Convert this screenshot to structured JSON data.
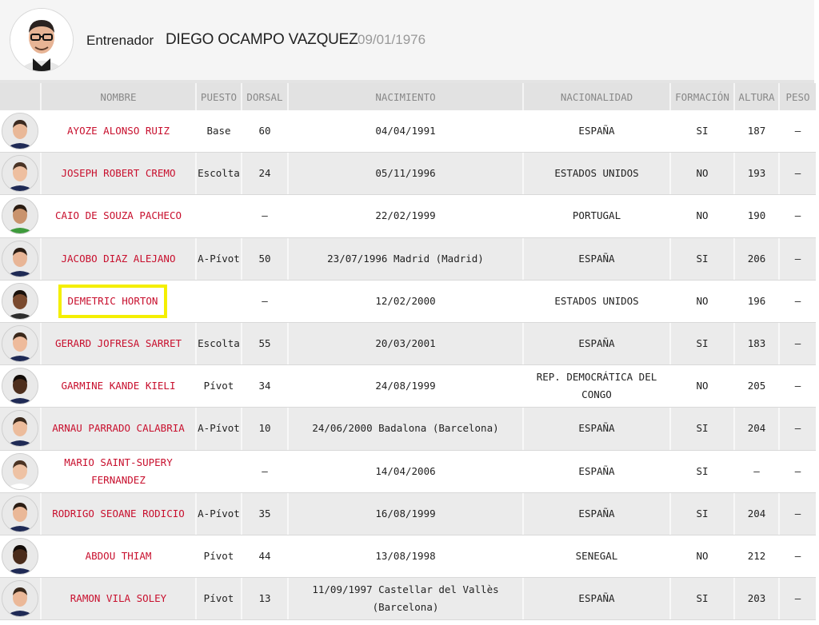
{
  "coach": {
    "role": "Entrenador",
    "name": "DIEGO OCAMPO VAZQUEZ",
    "birthdate": "09/01/1976"
  },
  "headers": {
    "nombre": "NOMBRE",
    "puesto": "PUESTO",
    "dorsal": "DORSAL",
    "nacimiento": "NACIMIENTO",
    "nacionalidad": "NACIONALIDAD",
    "formacion": "FORMACIÓN",
    "altura": "ALTURA",
    "peso": "PESO"
  },
  "colors": {
    "link": "#c8102e",
    "highlight": "#f4ef00",
    "header_bg": "#e2e2e2",
    "alt_row": "#ebebeb"
  },
  "highlighted_index": 4,
  "players": [
    {
      "name": "AYOZE ALONSO RUIZ",
      "position": "Base",
      "number": "60",
      "birth": "04/04/1991",
      "nationality": "ESPAÑA",
      "formation": "SI",
      "height": "187",
      "weight": "–",
      "skin": "#e9b898",
      "hair": "#3b2a20",
      "jersey": "#1f2a55"
    },
    {
      "name": "JOSEPH ROBERT CREMO",
      "position": "Escolta",
      "number": "24",
      "birth": "05/11/1996",
      "nationality": "ESTADOS UNIDOS",
      "formation": "NO",
      "height": "193",
      "weight": "–",
      "skin": "#eebfa0",
      "hair": "#4a3426",
      "jersey": "#1f2a55"
    },
    {
      "name": "CAIO DE SOUZA PACHECO",
      "position": "",
      "number": "–",
      "birth": "22/02/1999",
      "nationality": "PORTUGAL",
      "formation": "NO",
      "height": "190",
      "weight": "–",
      "skin": "#c9936d",
      "hair": "#2a1c12",
      "jersey": "#3d9a3b"
    },
    {
      "name": "JACOBO DIAZ ALEJANO",
      "position": "A-Pívot",
      "number": "50",
      "birth": "23/07/1996 Madrid (Madrid)",
      "nationality": "ESPAÑA",
      "formation": "SI",
      "height": "206",
      "weight": "–",
      "skin": "#e8b596",
      "hair": "#2b1d14",
      "jersey": "#1f2a55"
    },
    {
      "name": "DEMETRIC HORTON",
      "position": "",
      "number": "–",
      "birth": "12/02/2000",
      "nationality": "ESTADOS UNIDOS",
      "formation": "NO",
      "height": "196",
      "weight": "–",
      "skin": "#7a4a2e",
      "hair": "#1a110b",
      "jersey": "#2d2d2d"
    },
    {
      "name": "GERARD JOFRESA SARRET",
      "position": "Escolta",
      "number": "55",
      "birth": "20/03/2001",
      "nationality": "ESPAÑA",
      "formation": "SI",
      "height": "183",
      "weight": "–",
      "skin": "#eebb9c",
      "hair": "#3a281b",
      "jersey": "#1f2a55"
    },
    {
      "name": "GARMINE KANDE KIELI",
      "position": "Pívot",
      "number": "34",
      "birth": "24/08/1999",
      "nationality": "REP. DEMOCRÁTICA DEL CONGO",
      "formation": "NO",
      "height": "205",
      "weight": "–",
      "skin": "#4e2f1d",
      "hair": "#120b07",
      "jersey": "#1f2a55"
    },
    {
      "name": "ARNAU PARRADO CALABRIA",
      "position": "A-Pívot",
      "number": "10",
      "birth": "24/06/2000 Badalona (Barcelona)",
      "nationality": "ESPAÑA",
      "formation": "SI",
      "height": "204",
      "weight": "–",
      "skin": "#ecbc9c",
      "hair": "#3c2a1d",
      "jersey": "#1f2a55"
    },
    {
      "name": "MARIO SAINT-SUPERY FERNANDEZ",
      "position": "",
      "number": "–",
      "birth": "14/04/2006",
      "nationality": "ESPAÑA",
      "formation": "SI",
      "height": "–",
      "weight": "–",
      "skin": "#eec2a4",
      "hair": "#4b3323",
      "jersey": "#ffffff"
    },
    {
      "name": "RODRIGO SEOANE RODICIO",
      "position": "A-Pívot",
      "number": "35",
      "birth": "16/08/1999",
      "nationality": "ESPAÑA",
      "formation": "SI",
      "height": "204",
      "weight": "–",
      "skin": "#eab898",
      "hair": "#2b1d14",
      "jersey": "#1f2a55"
    },
    {
      "name": "ABDOU THIAM",
      "position": "Pívot",
      "number": "44",
      "birth": "13/08/1998",
      "nationality": "SENEGAL",
      "formation": "NO",
      "height": "212",
      "weight": "–",
      "skin": "#4a2c1b",
      "hair": "#120b07",
      "jersey": "#1f2a55"
    },
    {
      "name": "RAMON VILA SOLEY",
      "position": "Pívot",
      "number": "13",
      "birth": "11/09/1997 Castellar del Vallès (Barcelona)",
      "nationality": "ESPAÑA",
      "formation": "SI",
      "height": "203",
      "weight": "–",
      "skin": "#ebb898",
      "hair": "#3a281b",
      "jersey": "#1f2a55"
    }
  ]
}
